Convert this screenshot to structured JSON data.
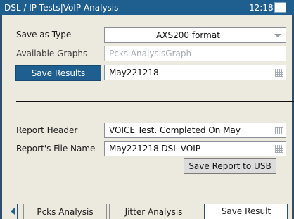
{
  "window": {
    "title": "DSL / IP Tests|VoIP Analysis",
    "clock": "12:18"
  },
  "save_as_type": {
    "label": "Save as Type",
    "value": "AXS200 format"
  },
  "available_graphs": {
    "label": "Available Graphs",
    "value": "Pcks AnalysisGraph"
  },
  "save_results": {
    "button_label": "Save Results",
    "value": "May221218"
  },
  "report_header": {
    "label": "Report Header",
    "value": "VOICE Test. Completed On May"
  },
  "report_file_name": {
    "label": "Report's File Name",
    "value": "May221218 DSL VOIP"
  },
  "save_report_button": "Save Report to USB",
  "tabs": [
    {
      "label": "Pcks Analysis",
      "active": false
    },
    {
      "label": "Jitter Analysis",
      "active": false
    },
    {
      "label": "Save Result",
      "active": true
    }
  ],
  "colors": {
    "titlebar": "#1f5f8f",
    "panel": "#ece9df",
    "accent_button": "#1f5f8f"
  }
}
